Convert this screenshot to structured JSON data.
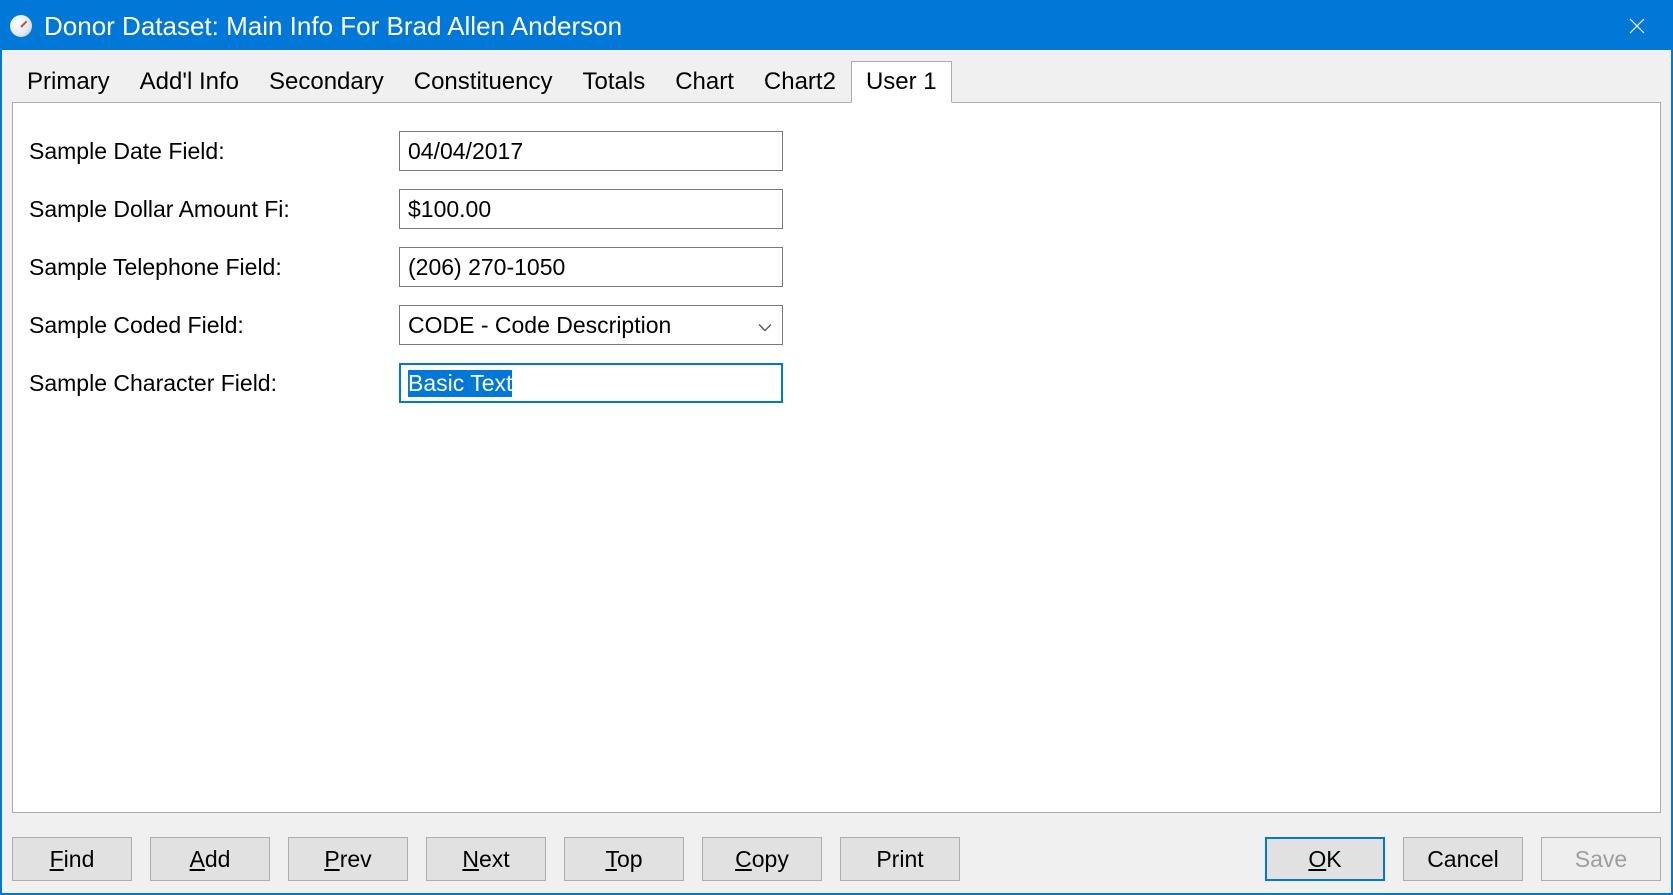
{
  "window": {
    "title": "Donor Dataset: Main Info For Brad Allen Anderson"
  },
  "tabs": [
    {
      "label": "Primary"
    },
    {
      "label": "Add'l Info"
    },
    {
      "label": "Secondary"
    },
    {
      "label": "Constituency"
    },
    {
      "label": "Totals"
    },
    {
      "label": "Chart"
    },
    {
      "label": "Chart2"
    },
    {
      "label": "User 1"
    }
  ],
  "active_tab_index": 7,
  "form": {
    "date": {
      "label": "Sample Date Field:",
      "value": "04/04/2017"
    },
    "dollar": {
      "label": "Sample Dollar Amount Fi:",
      "value": "$100.00"
    },
    "telephone": {
      "label": "Sample Telephone Field:",
      "value": "(206) 270-1050"
    },
    "coded": {
      "label": "Sample Coded Field:",
      "value": "CODE - Code Description"
    },
    "char": {
      "label": "Sample Character Field:",
      "value": "Basic Text"
    }
  },
  "footer": {
    "find": "Find",
    "add": "Add",
    "prev": "Prev",
    "next": "Next",
    "top": "Top",
    "copy": "Copy",
    "print": "Print",
    "ok": "OK",
    "cancel": "Cancel",
    "save": "Save"
  }
}
